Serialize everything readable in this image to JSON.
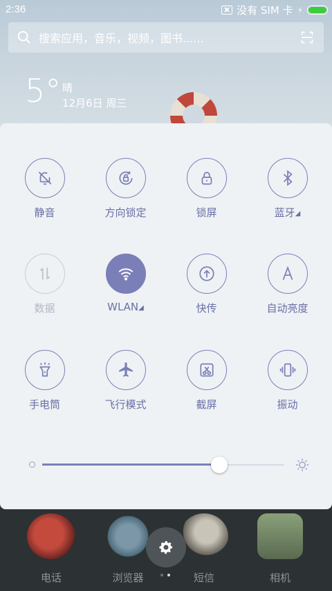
{
  "status": {
    "time": "2:36",
    "sim_text": "没有 SIM 卡",
    "battery_color": "#3ccd3c"
  },
  "search": {
    "placeholder": "搜索应用，音乐，视频，图书......"
  },
  "weather": {
    "temp": "5°",
    "condition": "晴",
    "date": "12月6日 周三"
  },
  "toggles": [
    {
      "label": "静音",
      "icon": "bell-off-icon",
      "state": "off"
    },
    {
      "label": "方向锁定",
      "icon": "rotation-lock-icon",
      "state": "off"
    },
    {
      "label": "锁屏",
      "icon": "lock-icon",
      "state": "off"
    },
    {
      "label": "蓝牙",
      "icon": "bluetooth-icon",
      "state": "off",
      "has_menu": true
    },
    {
      "label": "数据",
      "icon": "data-arrows-icon",
      "state": "disabled"
    },
    {
      "label": "WLAN",
      "icon": "wifi-icon",
      "state": "on",
      "has_menu": true
    },
    {
      "label": "快传",
      "icon": "upload-icon",
      "state": "off"
    },
    {
      "label": "自动亮度",
      "icon": "auto-brightness-icon",
      "state": "off"
    },
    {
      "label": "手电筒",
      "icon": "flashlight-icon",
      "state": "off"
    },
    {
      "label": "飞行模式",
      "icon": "airplane-icon",
      "state": "off"
    },
    {
      "label": "截屏",
      "icon": "screenshot-icon",
      "state": "off"
    },
    {
      "label": "振动",
      "icon": "vibrate-icon",
      "state": "off"
    }
  ],
  "brightness": {
    "level": 0.73
  },
  "dock": [
    {
      "label": "电话",
      "icon": "phone-app-icon"
    },
    {
      "label": "浏览器",
      "icon": "browser-app-icon"
    },
    {
      "label": "短信",
      "icon": "sms-app-icon"
    },
    {
      "label": "相机",
      "icon": "camera-app-icon"
    }
  ],
  "pager": {
    "pages": 2,
    "current": 2
  },
  "colors": {
    "accent": "#7b7fb8",
    "panel_bg": "#eef2f4"
  }
}
